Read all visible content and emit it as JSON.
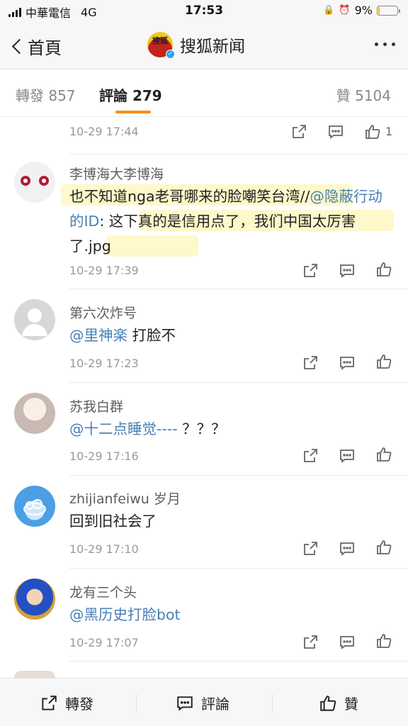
{
  "status_bar": {
    "carrier": "中華電信",
    "network": "4G",
    "time": "17:53",
    "battery": "9%",
    "battery_level": 0.09,
    "battery_color": "#f5b800"
  },
  "nav": {
    "back_label": "首頁",
    "avatar_text": "搜狐",
    "title": "搜狐新闻"
  },
  "tabs": {
    "repost_label": "轉發",
    "repost_count": "857",
    "comment_label": "評論",
    "comment_count": "279",
    "like_label": "贊",
    "like_count": "5104",
    "active_color": "#f78f18"
  },
  "comments": [
    {
      "time": "10-29 17:44",
      "likes": "1"
    },
    {
      "name": "李博海大李博海",
      "text_before": "也不知道nga老哥哪来的脸嘲笑台湾//",
      "mention": "@隐蔽行动的ID",
      "text_after": ": 这下真的是信用点了，我们中国太厉害了.jpg",
      "time": "10-29 17:39"
    },
    {
      "name": "第六次炸号",
      "mention": "@里神楽",
      "text_after": " 打脸不",
      "time": "10-29 17:23"
    },
    {
      "name": "苏我白群",
      "mention": "@十二点睡觉----",
      "text_after": " ？？？",
      "time": "10-29 17:16"
    },
    {
      "name": "zhijianfeiwu 岁月",
      "text_after": "回到旧社会了",
      "time": "10-29 17:10"
    },
    {
      "name": "龙有三个头",
      "mention": "@黑历史打脸bot",
      "time": "10-29 17:07"
    }
  ],
  "bottom_bar": {
    "repost": "轉發",
    "comment": "評論",
    "like": "贊"
  },
  "colors": {
    "mention": "#4a7fb5",
    "highlight": "#fdf6b8"
  }
}
